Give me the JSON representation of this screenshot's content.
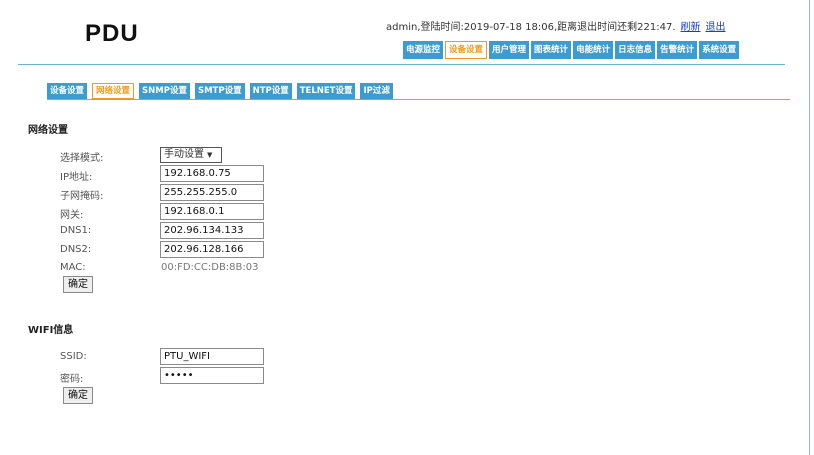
{
  "logo": "PDU",
  "session": {
    "text": "admin,登陆时间:2019-07-18 18:06,距离退出时间还剩221:47.",
    "refresh_label": "刷新",
    "logout_label": "退出"
  },
  "main_nav": [
    "电源监控",
    "设备设置",
    "用户管理",
    "图表统计",
    "电能统计",
    "日志信息",
    "告警统计",
    "系统设置"
  ],
  "main_nav_active": "设备设置",
  "sub_nav": [
    "设备设置",
    "网络设置",
    "SNMP设置",
    "SMTP设置",
    "NTP设置",
    "TELNET设置",
    "IP过滤"
  ],
  "sub_nav_active": "网络设置",
  "network": {
    "title": "网络设置",
    "mode_label": "选择模式:",
    "mode_value": "手动设置",
    "ip_label": "IP地址:",
    "ip_value": "192.168.0.75",
    "mask_label": "子网掩码:",
    "mask_value": "255.255.255.0",
    "gateway_label": "网关:",
    "gateway_value": "192.168.0.1",
    "dns1_label": "DNS1:",
    "dns1_value": "202.96.134.133",
    "dns2_label": "DNS2:",
    "dns2_value": "202.96.128.166",
    "mac_label": "MAC:",
    "mac_value": "00:FD:CC:DB:8B:03",
    "confirm_label": "确定"
  },
  "wifi": {
    "title": "WIFI信息",
    "ssid_label": "SSID:",
    "ssid_value": "PTU_WIFI",
    "password_label": "密码:",
    "password_value": "•••••",
    "confirm_label": "确定"
  },
  "colors": {
    "nav_blue": "#3d9ccf",
    "active_orange": "#f39a1e",
    "link_blue": "#1a3fcc"
  }
}
